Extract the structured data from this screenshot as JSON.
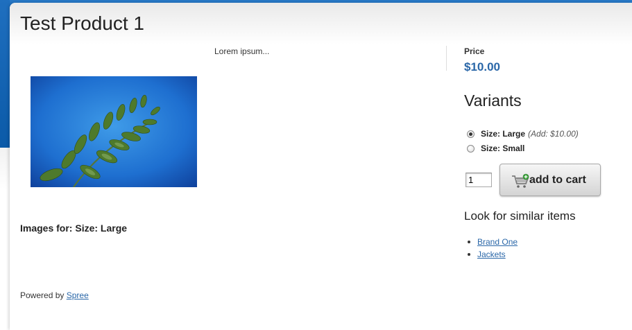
{
  "product": {
    "title": "Test Product 1",
    "description": "Lorem ipsum...",
    "images_for": "Images for: Size: Large"
  },
  "price": {
    "label": "Price",
    "value": "$10.00"
  },
  "variants": {
    "title": "Variants",
    "items": [
      {
        "label": "Size: Large",
        "extra": "(Add: $10.00)",
        "selected": true
      },
      {
        "label": "Size: Small",
        "extra": "",
        "selected": false
      }
    ]
  },
  "cart": {
    "quantity": "1",
    "button_label": "add to cart"
  },
  "similar": {
    "title": "Look for similar items",
    "links": [
      "Brand One",
      "Jackets"
    ]
  },
  "footer": {
    "text": "Powered by",
    "link": "Spree"
  },
  "colors": {
    "link": "#2a67a8",
    "header_blue": "#136bbd"
  },
  "icons": {
    "cart": "shopping-cart-add-icon"
  }
}
